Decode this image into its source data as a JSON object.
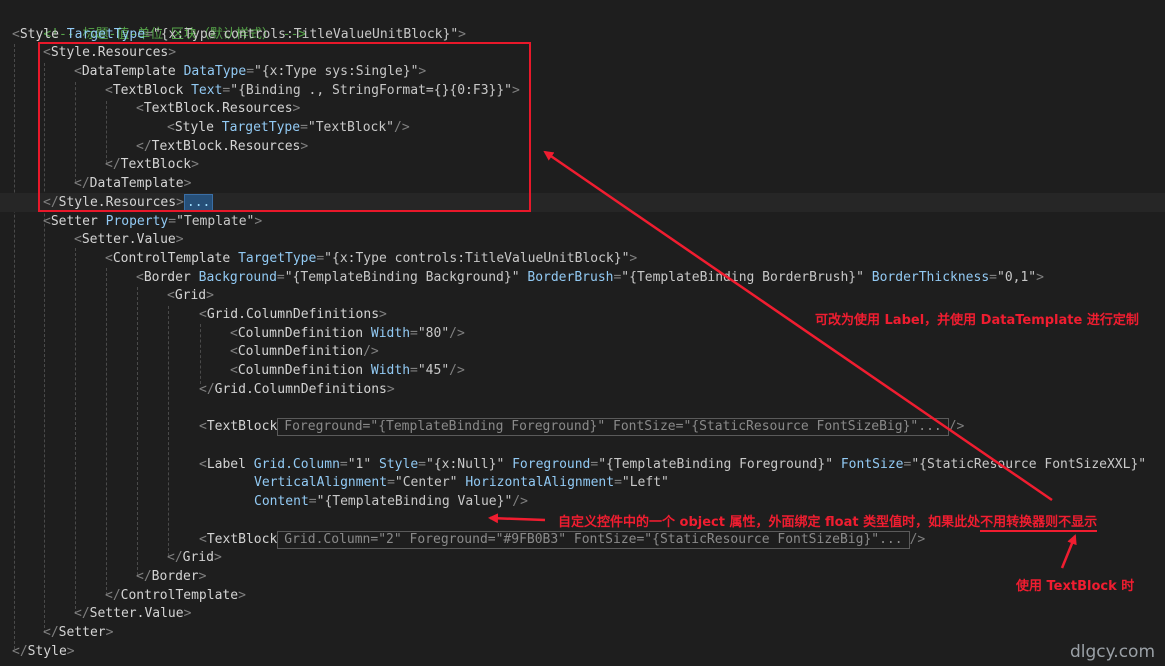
{
  "comment": "<!-- 标题-值-单位 区块（默认样式） -->",
  "lines": {
    "l2": {
      "tag": "Style",
      "attr": "TargetType",
      "val": "\"{x:Type controls:TitleValueUnitBlock}\""
    },
    "l3": "Style.Resources",
    "l4": {
      "tag": "DataTemplate",
      "attr": "DataType",
      "val": "\"{x:Type sys:Single}\""
    },
    "l5": {
      "tag": "TextBlock",
      "attr": "Text",
      "val": "\"{Binding ., StringFormat={}{0:F3}}\""
    },
    "l6": "TextBlock.Resources",
    "l7": {
      "tag": "Style",
      "attr": "TargetType",
      "val": "\"TextBlock\""
    },
    "l8": "TextBlock.Resources",
    "l9": "TextBlock",
    "l10": "DataTemplate",
    "l11": {
      "tag": "Style.Resources",
      "collapsed": "..."
    },
    "l12": {
      "tag": "Setter",
      "attr": "Property",
      "val": "\"Template\""
    },
    "l13": "Setter.Value",
    "l14": {
      "tag": "ControlTemplate",
      "attr": "TargetType",
      "val": "\"{x:Type controls:TitleValueUnitBlock}\""
    },
    "l15": {
      "tag": "Border",
      "a1": "Background",
      "v1": "\"{TemplateBinding Background}\"",
      "a2": "BorderBrush",
      "v2": "\"{TemplateBinding BorderBrush}\"",
      "a3": "BorderThickness",
      "v3": "\"0,1\""
    },
    "l16": "Grid",
    "l17": "Grid.ColumnDefinitions",
    "l18": {
      "tag": "ColumnDefinition",
      "attr": "Width",
      "val": "\"80\""
    },
    "l19": "ColumnDefinition",
    "l20": {
      "tag": "ColumnDefinition",
      "attr": "Width",
      "val": "\"45\""
    },
    "l21": "Grid.ColumnDefinitions",
    "l23": {
      "tag": "TextBlock",
      "folded": "Foreground=\"{TemplateBinding Foreground}\" FontSize=\"{StaticResource FontSizeBig}\"..."
    },
    "l25": {
      "tag": "Label",
      "a1": "Grid.Column",
      "v1": "\"1\"",
      "a2": "Style",
      "v2": "\"{x:Null}\"",
      "a3": "Foreground",
      "v3": "\"{TemplateBinding Foreground}\"",
      "a4": "FontSize",
      "v4": "\"{StaticResource FontSizeXXL}\""
    },
    "l26": {
      "a1": "VerticalAlignment",
      "v1": "\"Center\"",
      "a2": "HorizontalAlignment",
      "v2": "\"Left\""
    },
    "l27": {
      "a1": "Content",
      "v1": "\"{TemplateBinding Value}\""
    },
    "l29": {
      "tag": "TextBlock",
      "folded": "Grid.Column=\"2\" Foreground=\"#9FB0B3\" FontSize=\"{StaticResource FontSizeBig}\"..."
    },
    "l30": "Grid",
    "l31": "Border",
    "l32": "ControlTemplate",
    "l33": "Setter.Value",
    "l34": "Setter",
    "l35": "Style"
  },
  "annotations": {
    "label_note": "可改为使用 Label，并使用 DataTemplate 进行定制",
    "object_note_pre": "自定义控件中的一个 object 属性，外面绑定 float 类型值时，如果此处",
    "object_note_emph": "不用转换器则不显示",
    "textblock_note": "使用 TextBlock 时"
  },
  "watermark": "dlgcy.com",
  "colors": {
    "background": "#1e1e1e",
    "tag": "#d4d4d4",
    "attribute": "#92caf4",
    "value": "#c8c8c8",
    "comment": "#57a64a",
    "annotation": "#f01d30"
  }
}
